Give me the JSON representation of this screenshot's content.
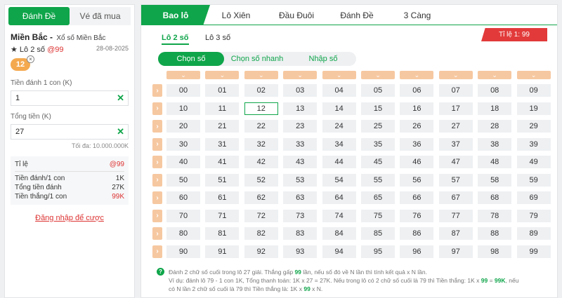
{
  "left": {
    "tabs": [
      "Đánh Đề",
      "Vé đã mua"
    ],
    "region_name": "Miền Bắc",
    "region_sep": " - ",
    "region_sub": "Xổ số Miền Bắc",
    "lo_prefix": "★ Lô 2 số ",
    "lo_odds": "@99",
    "date": "28-08-2025",
    "chip": "12",
    "chip_close": "×",
    "amount_label": "Tiền đánh 1 con (K)",
    "amount_value": "1",
    "total_label": "Tổng tiền (K)",
    "total_value": "27",
    "clear_icon": "✕",
    "max_text": "Tối đa: 10.000.000K",
    "summary": {
      "rate_label": "Tỉ lệ",
      "rate_value": "@99",
      "per_label": "Tiền đánh/1 con",
      "per_value": "1K",
      "sum_label": "Tổng tiền đánh",
      "sum_value": "27K",
      "win_label": "Tiền thắng/1 con",
      "win_value": "99K"
    },
    "login": "Đăng nhập để cược"
  },
  "right": {
    "nav": [
      "Bao lô",
      "Lô Xiên",
      "Đầu Đuôi",
      "Đánh Đề",
      "3 Càng"
    ],
    "sub": [
      "Lô 2 số",
      "Lô 3 số"
    ],
    "rate_badge": "Tỉ lệ 1: 99",
    "modes": [
      "Chọn số",
      "Chọn số nhanh",
      "Nhập số"
    ],
    "chevron_down": "⌄",
    "chevron_right": "›",
    "numbers": [
      "00",
      "01",
      "02",
      "03",
      "04",
      "05",
      "06",
      "07",
      "08",
      "09",
      "10",
      "11",
      "12",
      "13",
      "14",
      "15",
      "16",
      "17",
      "18",
      "19",
      "20",
      "21",
      "22",
      "23",
      "24",
      "25",
      "26",
      "27",
      "28",
      "29",
      "30",
      "31",
      "32",
      "33",
      "34",
      "35",
      "36",
      "37",
      "38",
      "39",
      "40",
      "41",
      "42",
      "43",
      "44",
      "45",
      "46",
      "47",
      "48",
      "49",
      "50",
      "51",
      "52",
      "53",
      "54",
      "55",
      "56",
      "57",
      "58",
      "59",
      "60",
      "61",
      "62",
      "63",
      "64",
      "65",
      "66",
      "67",
      "68",
      "69",
      "70",
      "71",
      "72",
      "73",
      "74",
      "75",
      "76",
      "77",
      "78",
      "79",
      "80",
      "81",
      "82",
      "83",
      "84",
      "85",
      "86",
      "87",
      "88",
      "89",
      "90",
      "91",
      "92",
      "93",
      "94",
      "95",
      "96",
      "97",
      "98",
      "99"
    ],
    "selected": "12",
    "help_icon": "?",
    "help": {
      "l1a": "Đánh 2 chữ số cuối trong lô 27 giải. Thắng gấp ",
      "l1b": "99",
      "l1c": " lần, nếu số đó về N lần thì tính kết quả x N lần.",
      "l2a": "Ví dụ: đánh lô 79 - 1 con 1K, Tổng thanh toán: 1K x 27 = 27K. Nếu trong lô có 2 chữ số cuối là 79 thì Tiền thắng: 1K x ",
      "l2b": "99",
      "l2c": " = ",
      "l2d": "99K",
      "l2e": ", nếu",
      "l3a": "có N lần 2 chữ số cuối là 79 thì Tiền thắng là: 1K x ",
      "l3b": "99",
      "l3c": " x N."
    }
  }
}
